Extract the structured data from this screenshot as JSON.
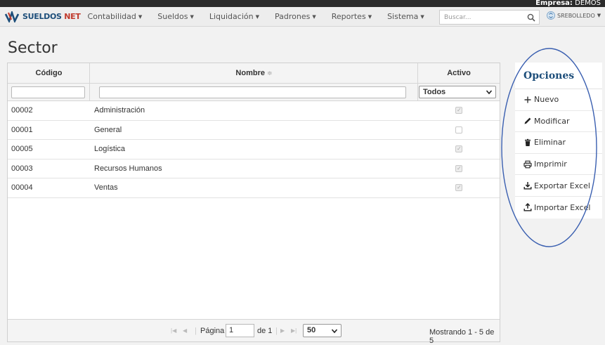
{
  "header": {
    "empresa_label": "Empresa:",
    "empresa_value": "DEMOS",
    "logo_main": "SUELDOS",
    "logo_accent": "NET",
    "menu": [
      {
        "label": "Contabilidad"
      },
      {
        "label": "Sueldos"
      },
      {
        "label": "Liquidación"
      },
      {
        "label": "Padrones"
      },
      {
        "label": "Reportes"
      },
      {
        "label": "Sistema"
      }
    ],
    "search_placeholder": "Buscar...",
    "user": "SREBOLLEDO"
  },
  "page": {
    "title": "Sector"
  },
  "grid": {
    "columns": [
      {
        "label": "Código"
      },
      {
        "label": "Nombre"
      },
      {
        "label": "Activo"
      }
    ],
    "sort_indicator": "≑",
    "filter_activo_value": "Todos",
    "rows": [
      {
        "codigo": "00002",
        "nombre": "Administración",
        "activo": true
      },
      {
        "codigo": "00001",
        "nombre": "General",
        "activo": false
      },
      {
        "codigo": "00005",
        "nombre": "Logística",
        "activo": true
      },
      {
        "codigo": "00003",
        "nombre": "Recursos Humanos",
        "activo": true
      },
      {
        "codigo": "00004",
        "nombre": "Ventas",
        "activo": true
      }
    ],
    "pager": {
      "page_label": "Página",
      "page_value": "1",
      "of_label": "de 1",
      "page_size": "50",
      "info": "Mostrando 1 - 5 de 5"
    }
  },
  "options": {
    "title": "Opciones",
    "items": [
      {
        "label": "Nuevo",
        "icon": "plus-icon"
      },
      {
        "label": "Modificar",
        "icon": "pencil-icon"
      },
      {
        "label": "Eliminar",
        "icon": "trash-icon"
      },
      {
        "label": "Imprimir",
        "icon": "print-icon"
      },
      {
        "label": "Exportar Excel",
        "icon": "download-icon"
      },
      {
        "label": "Importar Excel",
        "icon": "upload-icon"
      }
    ]
  },
  "colors": {
    "brand": "#1d4e7a",
    "accent": "#c0392b",
    "annotation": "#3a5fb0"
  }
}
